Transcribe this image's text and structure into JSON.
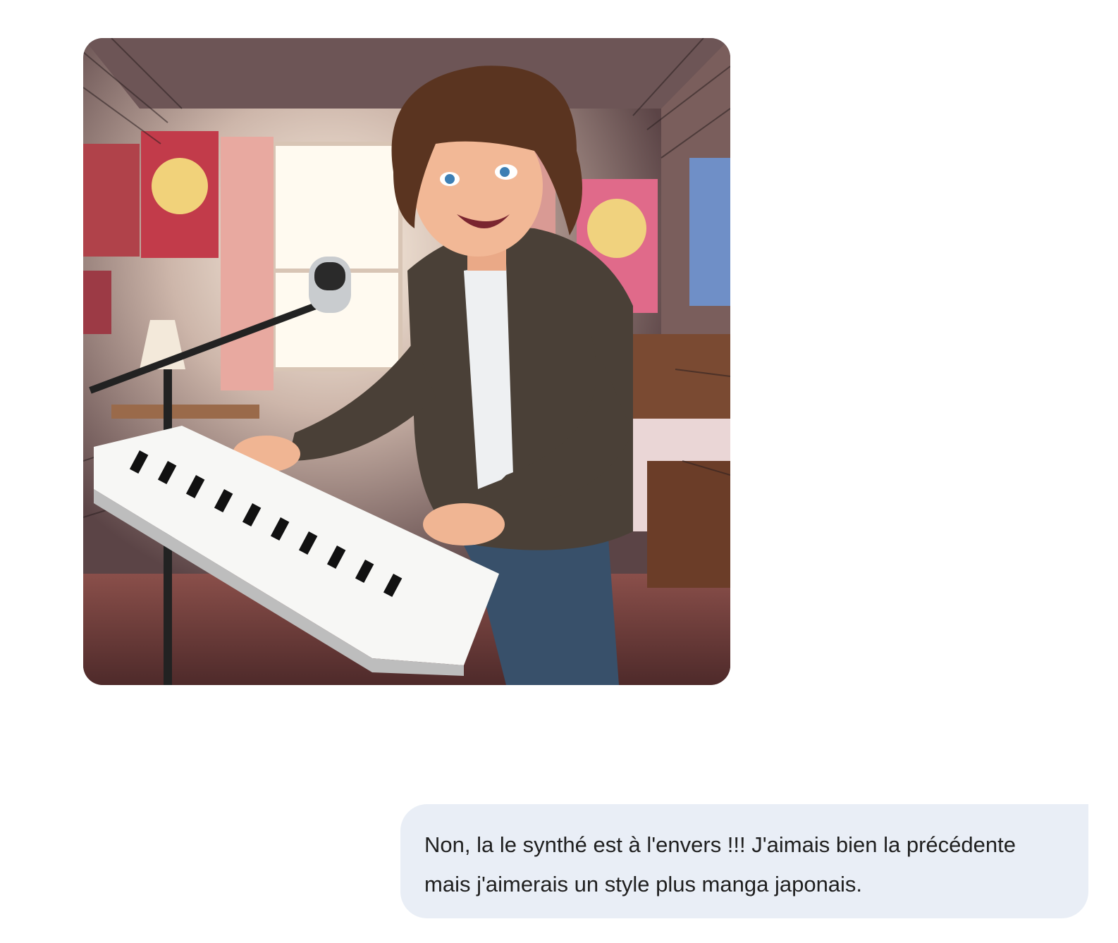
{
  "conversation": {
    "generated_image": {
      "alt": "Illustration of a curly-haired young person singing into a microphone while playing a synthesizer in a bedroom"
    },
    "user_message": {
      "text": "Non, la le synthé est à l'envers !!! J'aimais bien la précédente mais j'aimerais un style plus manga japonais."
    }
  },
  "colors": {
    "page_background": "#ffffff",
    "user_bubble_background": "#e9eef6",
    "text": "#1f1f1f"
  }
}
